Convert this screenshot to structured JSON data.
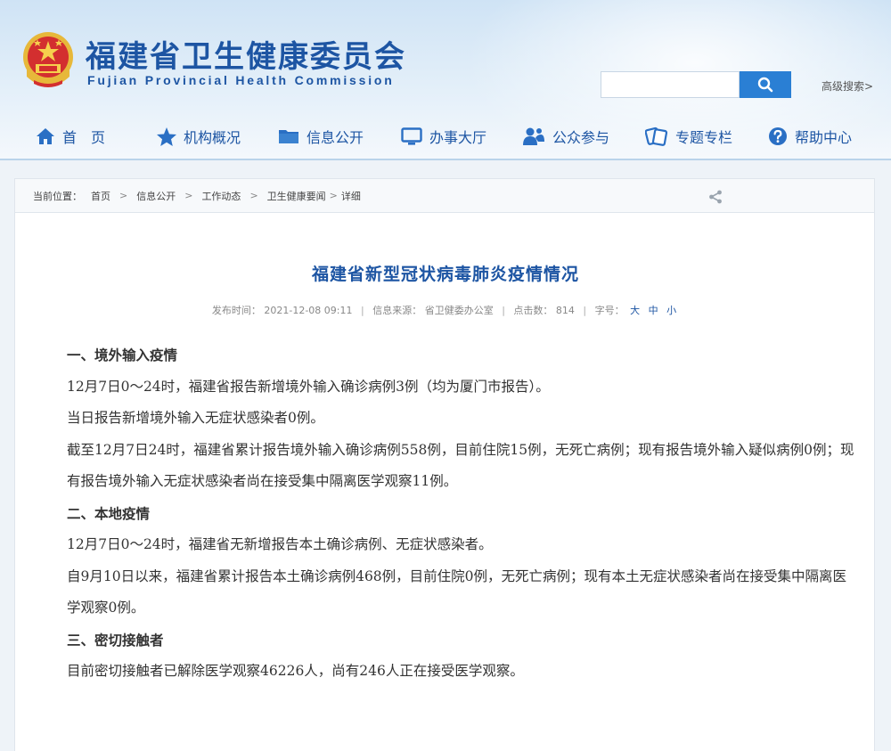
{
  "header": {
    "title_cn": "福建省卫生健康委员会",
    "title_en": "Fujian Provincial Health Commission",
    "search_placeholder": "",
    "advanced_search": "高级搜索>"
  },
  "nav": {
    "items": [
      {
        "label": "首　页",
        "icon": "home-icon"
      },
      {
        "label": "机构概况",
        "icon": "star-icon"
      },
      {
        "label": "信息公开",
        "icon": "folder-icon"
      },
      {
        "label": "办事大厅",
        "icon": "monitor-icon"
      },
      {
        "label": "公众参与",
        "icon": "people-icon"
      },
      {
        "label": "专题专栏",
        "icon": "cards-icon"
      },
      {
        "label": "帮助中心",
        "icon": "help-icon"
      }
    ],
    "active_index": 2,
    "accent_color": "#d9573a"
  },
  "breadcrumb": {
    "prefix": "当前位置：",
    "items": [
      "首页",
      "信息公开",
      "工作动态",
      "卫生健康要闻",
      "详细"
    ]
  },
  "article": {
    "title": "福建省新型冠状病毒肺炎疫情情况",
    "meta": {
      "publish_label": "发布时间：",
      "publish_time": "2021-12-08 09:11",
      "source_label": "信息来源：",
      "source": "省卫健委办公室",
      "clicks_label": "点击数：",
      "clicks": "814",
      "font_label": "字号：",
      "sizes": [
        "大",
        "中",
        "小"
      ]
    },
    "paragraphs": [
      {
        "text": "一、境外输入疫情",
        "heading": true
      },
      {
        "text": "12月7日0～24时，福建省报告新增境外输入确诊病例3例（均为厦门市报告）。",
        "heading": false
      },
      {
        "text": "当日报告新增境外输入无症状感染者0例。",
        "heading": false
      },
      {
        "text": "截至12月7日24时，福建省累计报告境外输入确诊病例558例，目前住院15例，无死亡病例；现有报告境外输入疑似病例0例；现有报告境外输入无症状感染者尚在接受集中隔离医学观察11例。",
        "heading": false
      },
      {
        "text": "二、本地疫情",
        "heading": true
      },
      {
        "text": "12月7日0～24时，福建省无新增报告本土确诊病例、无症状感染者。",
        "heading": false
      },
      {
        "text": "自9月10日以来，福建省累计报告本土确诊病例468例，目前住院0例，无死亡病例；现有本土无症状感染者尚在接受集中隔离医学观察0例。",
        "heading": false
      },
      {
        "text": "三、密切接触者",
        "heading": true
      },
      {
        "text": "目前密切接触者已解除医学观察46226人，尚有246人正在接受医学观察。",
        "heading": false
      }
    ]
  },
  "colors": {
    "brand_blue": "#1d55a3",
    "search_button": "#2a7fd4"
  }
}
